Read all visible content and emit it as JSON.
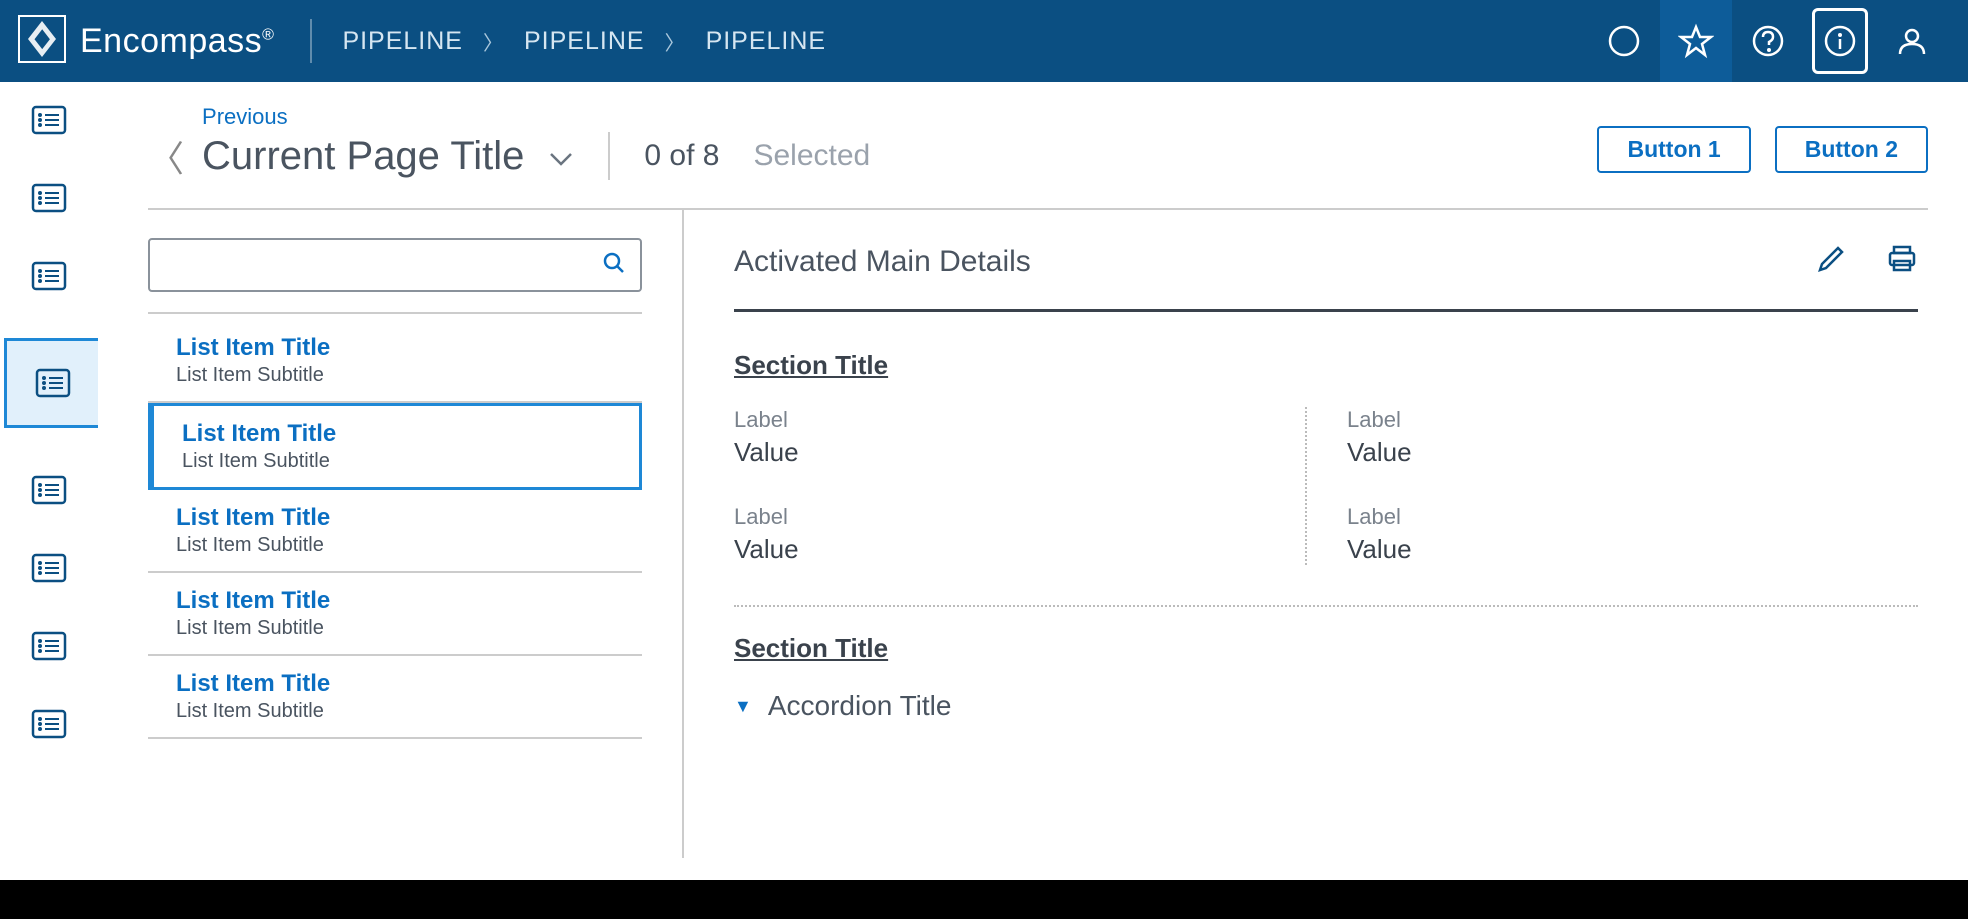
{
  "header": {
    "brand": "Encompass",
    "breadcrumbs": [
      "PIPELINE",
      "PIPELINE",
      "PIPELINE"
    ]
  },
  "page": {
    "previous": "Previous",
    "title": "Current Page Title",
    "selection_count": "0 of 8",
    "selection_label": "Selected",
    "button1": "Button 1",
    "button2": "Button 2"
  },
  "list": {
    "items": [
      {
        "title": "List Item Title",
        "subtitle": "List Item Subtitle"
      },
      {
        "title": "List Item Title",
        "subtitle": "List Item Subtitle"
      },
      {
        "title": "List Item Title",
        "subtitle": "List Item Subtitle"
      },
      {
        "title": "List Item Title",
        "subtitle": "List Item Subtitle"
      },
      {
        "title": "List Item Title",
        "subtitle": "List Item Subtitle"
      }
    ]
  },
  "details": {
    "title": "Activated Main Details",
    "section1": {
      "title": "Section Title",
      "fields": [
        {
          "label": "Label",
          "value": "Value"
        },
        {
          "label": "Label",
          "value": "Value"
        },
        {
          "label": "Label",
          "value": "Value"
        },
        {
          "label": "Label",
          "value": "Value"
        }
      ]
    },
    "section2": {
      "title": "Section Title",
      "accordion": "Accordion Title"
    }
  }
}
